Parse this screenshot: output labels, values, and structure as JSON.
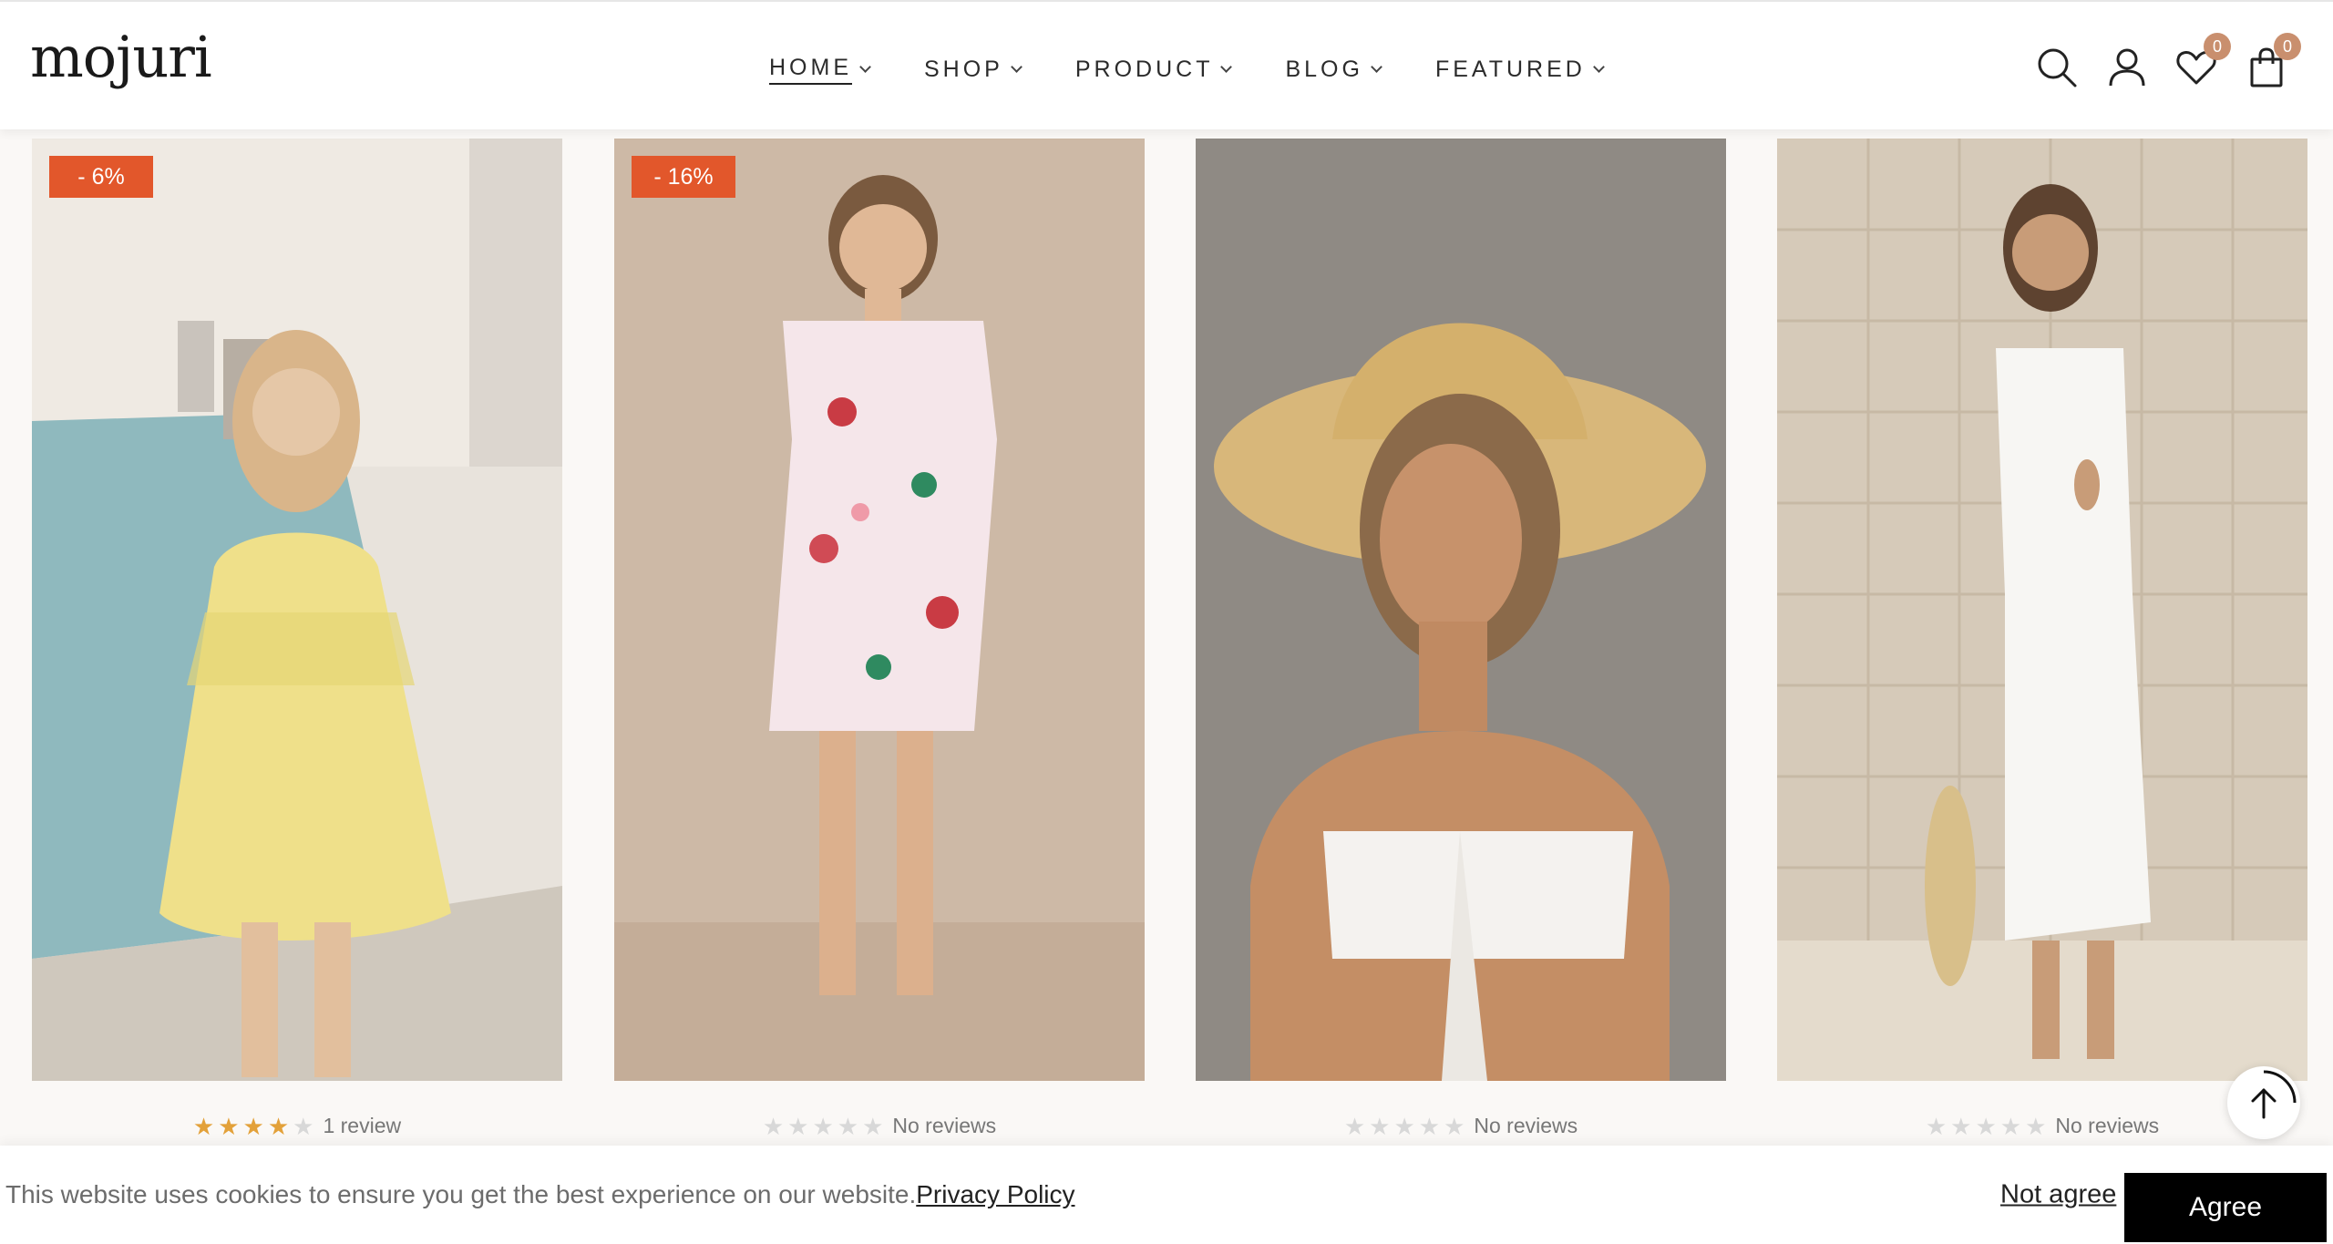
{
  "header": {
    "logo": "mojuri",
    "nav": [
      {
        "label": "HOME"
      },
      {
        "label": "SHOP"
      },
      {
        "label": "PRODUCT"
      },
      {
        "label": "BLOG"
      },
      {
        "label": "FEATURED"
      }
    ],
    "active_nav": "HOME",
    "wishlist_count": "0",
    "cart_count": "0",
    "icons": [
      "search-icon",
      "account-icon",
      "heart-icon",
      "bag-icon"
    ]
  },
  "products": [
    {
      "badge": "- 6%",
      "rating": 4,
      "reviews": "1 review",
      "image": "woman in yellow lemon-print sundress by a pool"
    },
    {
      "badge": "- 16%",
      "rating": 0,
      "reviews": "No reviews",
      "image": "woman in pink floral mini dress"
    },
    {
      "badge": "",
      "rating": 0,
      "reviews": "No reviews",
      "image": "woman in straw sun hat and white bandeau top"
    },
    {
      "badge": "",
      "rating": 0,
      "reviews": "No reviews",
      "image": "woman in white one-shoulder maxi dress"
    }
  ],
  "cookie": {
    "text": "This website uses cookies to ensure you get the best experience on our website.",
    "link": "Privacy Policy",
    "not_agree": "Not agree",
    "agree": "Agree"
  },
  "colors": {
    "sale_badge": "#e2572b",
    "star_on": "#e3a13a",
    "star_off": "#d8d8d8",
    "counter_badge": "#c98f6e",
    "agree_button": "#000000"
  }
}
